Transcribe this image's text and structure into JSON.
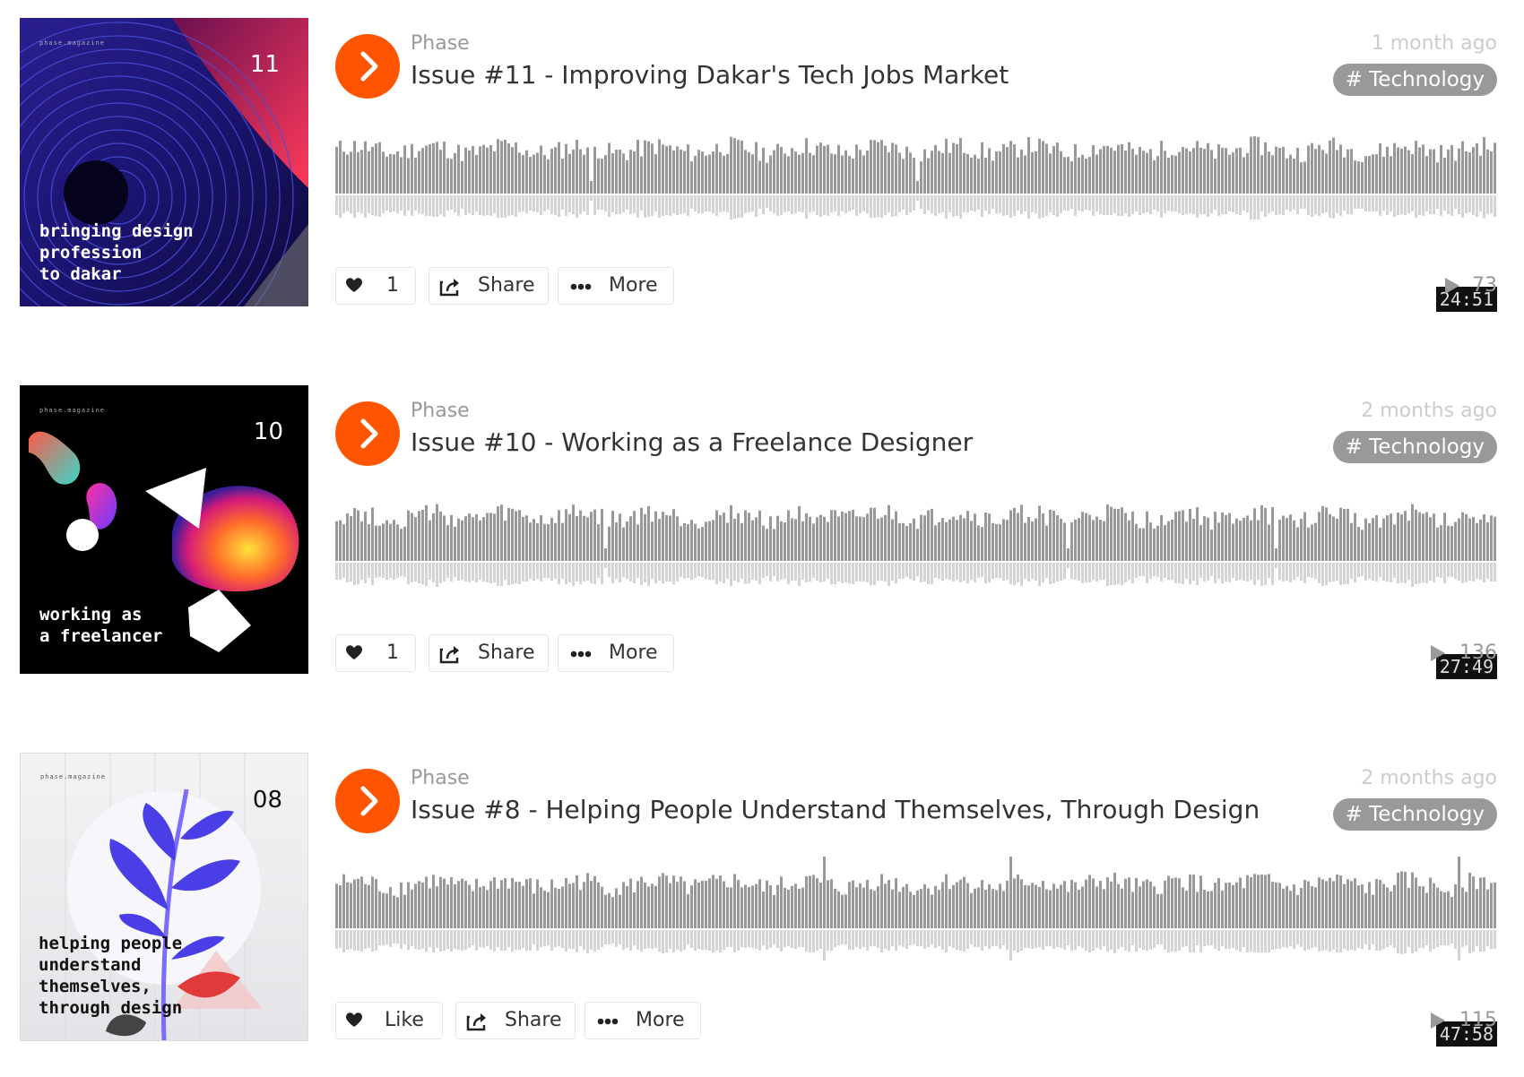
{
  "colors": {
    "accent": "#ff5500",
    "tag_bg": "#999999",
    "wave": "#999999",
    "wave_reflection": "#d4d4d4"
  },
  "tracks": [
    {
      "uploader": "Phase",
      "title": "Issue #11 - Improving Dakar's Tech Jobs Market",
      "time_ago": "1 month ago",
      "tag": "# Technology",
      "duration": "24:51",
      "like_label": "1",
      "share_label": "Share",
      "more_label": "More",
      "plays": "73",
      "artwork": {
        "brand": "phase.magazine",
        "issue": "11",
        "lines": [
          "bringing design",
          "profession",
          "to dakar"
        ]
      }
    },
    {
      "uploader": "Phase",
      "title": "Issue #10 - Working as a Freelance Designer",
      "time_ago": "2 months ago",
      "tag": "# Technology",
      "duration": "27:49",
      "like_label": "1",
      "share_label": "Share",
      "more_label": "More",
      "plays": "136",
      "artwork": {
        "brand": "phase.magazine",
        "issue": "10",
        "lines": [
          "working as",
          "a freelancer"
        ]
      }
    },
    {
      "uploader": "Phase",
      "title": "Issue #8 - Helping People Understand Themselves, Through Design",
      "time_ago": "2 months ago",
      "tag": "# Technology",
      "duration": "47:58",
      "like_label": "Like",
      "share_label": "Share",
      "more_label": "More",
      "plays": "115",
      "artwork": {
        "brand": "phase.magazine",
        "issue": "08",
        "lines": [
          "helping people",
          "understand",
          "themselves,",
          "through design"
        ]
      }
    }
  ]
}
